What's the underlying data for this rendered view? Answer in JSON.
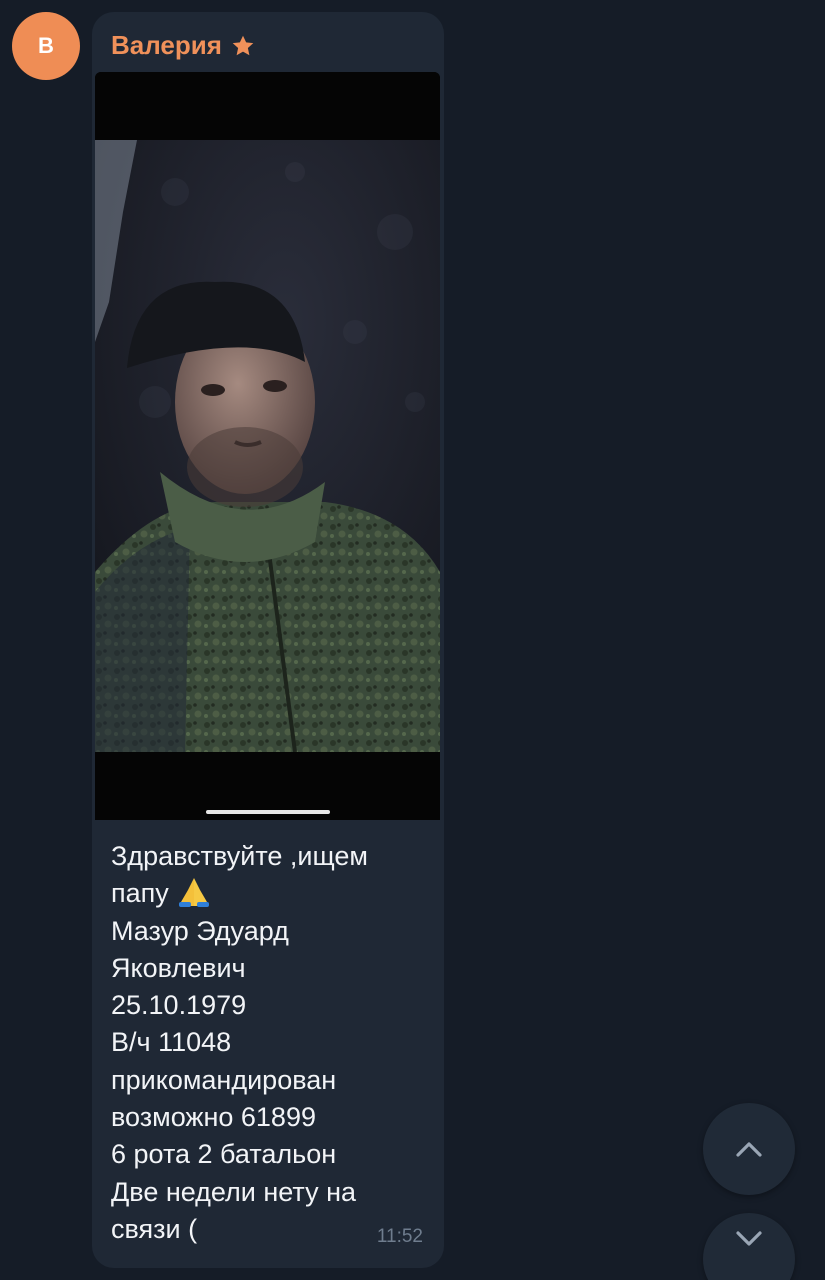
{
  "avatar": {
    "letter": "В",
    "color": "#ef8d55"
  },
  "message": {
    "sender": "Валерия",
    "sender_badge": "star-icon",
    "photo_description_icon": "photo",
    "lines": [
      "Здравствуйте ,ищем",
      "папу",
      "Мазур Эдуард",
      "Яковлевич",
      "25.10.1979",
      "В/ч 11048",
      "прикомандирован",
      "возможно 61899",
      "6 рота 2 батальон",
      "Две недели нету на",
      "связи ("
    ],
    "emoji": "folded-hands",
    "time": "11:52"
  },
  "controls": {
    "scroll_up_icon": "chevron-up-icon",
    "scroll_down_icon": "chevron-down-icon"
  },
  "colors": {
    "background": "#151c27",
    "bubble": "#1f2835",
    "sender": "#f0915a",
    "text": "#f2f4f7",
    "time": "#6f7d8e"
  }
}
